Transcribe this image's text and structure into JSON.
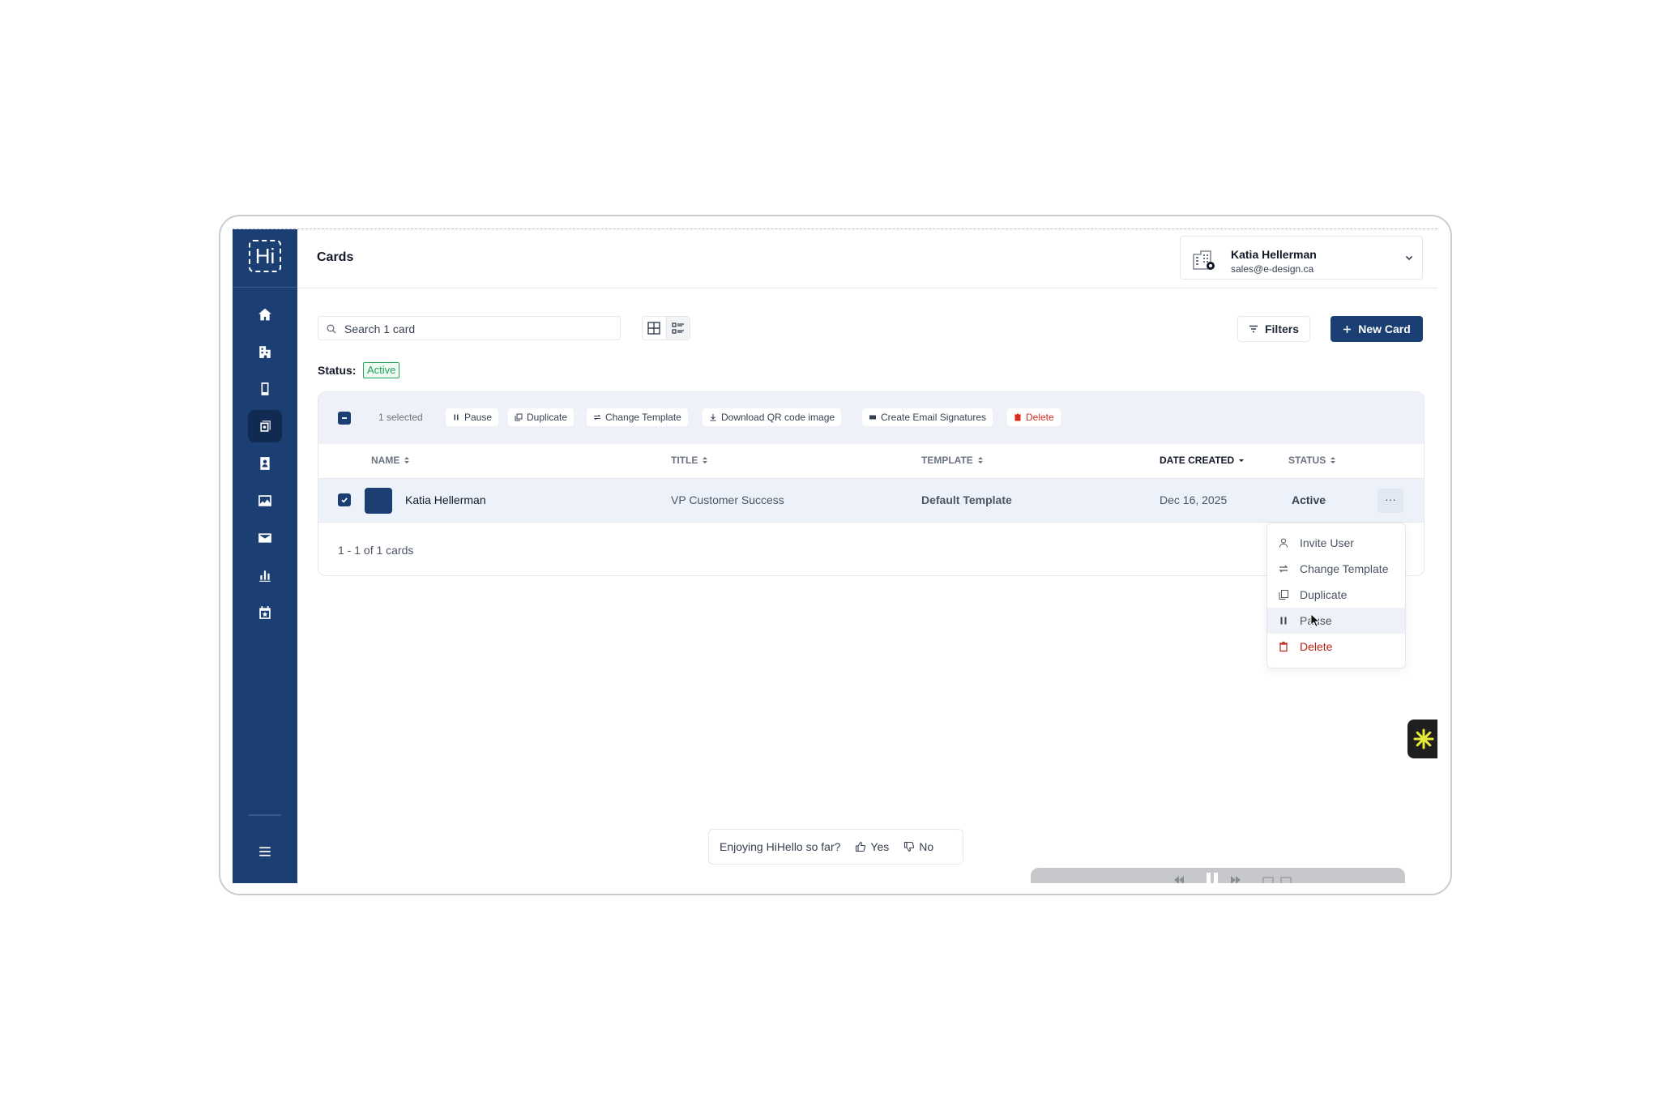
{
  "app": {
    "logo_text": "Hi",
    "page_title": "Cards"
  },
  "sidebar": {
    "items": [
      {
        "icon": "home-icon"
      },
      {
        "icon": "building-icon"
      },
      {
        "icon": "phone-icon"
      },
      {
        "icon": "cards-icon",
        "active": true
      },
      {
        "icon": "contacts-icon"
      },
      {
        "icon": "image-icon"
      },
      {
        "icon": "mail-icon"
      },
      {
        "icon": "chart-icon"
      },
      {
        "icon": "calendar-star-icon"
      }
    ],
    "menu_icon": "hamburger-icon"
  },
  "account": {
    "name": "Katia Hellerman",
    "email": "sales@e-design.ca"
  },
  "search": {
    "placeholder": "Search 1 card"
  },
  "toolbar": {
    "filters_label": "Filters",
    "new_card_label": "New Card"
  },
  "status_filter": {
    "label": "Status:",
    "value": "Active"
  },
  "bulk": {
    "selected_text": "1 selected",
    "actions": [
      "Pause",
      "Duplicate",
      "Change Template",
      "Download QR code image",
      "Create Email Signatures",
      "Delete"
    ]
  },
  "table": {
    "columns": [
      "NAME",
      "TITLE",
      "TEMPLATE",
      "DATE CREATED",
      "STATUS"
    ],
    "sorted_column": "DATE CREATED",
    "rows": [
      {
        "name": "Katia Hellerman",
        "title": "VP Customer Success",
        "template": "Default Template",
        "date": "Dec 16, 2025",
        "status": "Active",
        "selected": true
      }
    ],
    "more_label": "···",
    "pagination": "1 - 1 of 1 cards"
  },
  "row_menu": {
    "items": [
      "Invite User",
      "Change Template",
      "Duplicate",
      "Pause",
      "Delete"
    ],
    "hovered": "Pause"
  },
  "feedback": {
    "question": "Enjoying HiHello so far?",
    "yes": "Yes",
    "no": "No"
  },
  "colors": {
    "brand": "#1b3e73",
    "active": "#22a35a",
    "danger": "#d92d20"
  }
}
